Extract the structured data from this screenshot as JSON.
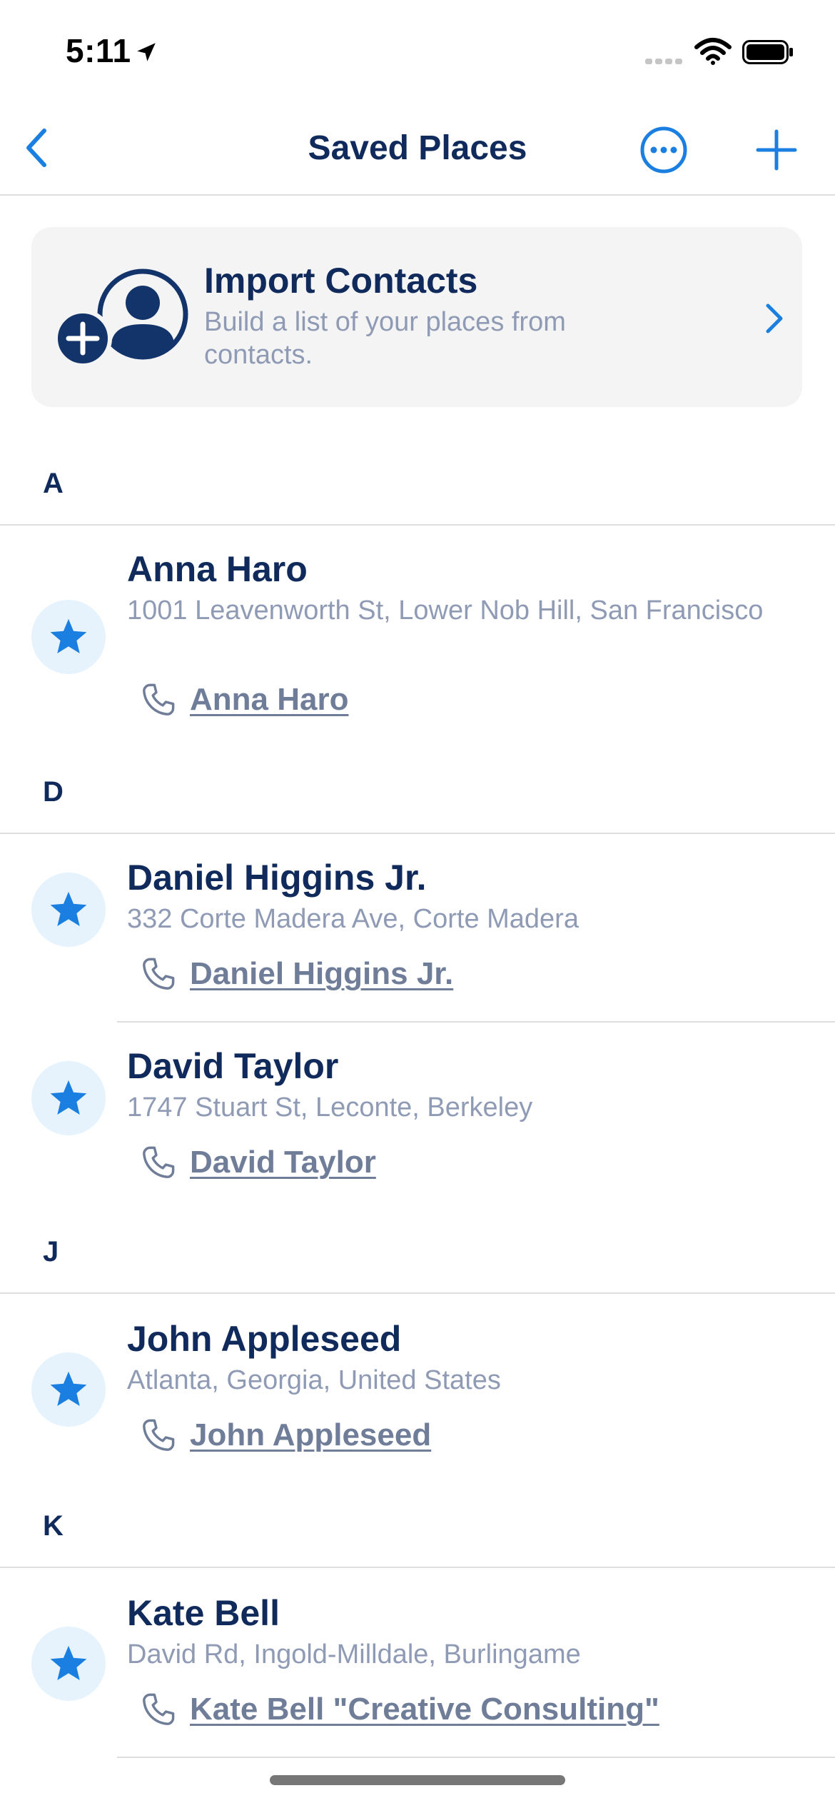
{
  "status_bar": {
    "time": "5:11"
  },
  "nav": {
    "title": "Saved Places"
  },
  "import_card": {
    "title": "Import Contacts",
    "description": "Build a list of your places from contacts."
  },
  "sections": [
    {
      "letter": "A",
      "contacts": [
        {
          "name": "Anna Haro",
          "address": "1001 Leavenworth St, Lower Nob Hill, San Francisco",
          "phone_label": "Anna Haro"
        }
      ]
    },
    {
      "letter": "D",
      "contacts": [
        {
          "name": "Daniel Higgins Jr.",
          "address": "332 Corte Madera Ave, Corte Madera",
          "phone_label": "Daniel Higgins Jr."
        },
        {
          "name": "David Taylor",
          "address": "1747 Stuart St, Leconte, Berkeley",
          "phone_label": "David Taylor"
        }
      ]
    },
    {
      "letter": "J",
      "contacts": [
        {
          "name": "John Appleseed",
          "address": "Atlanta, Georgia, United States",
          "phone_label": "John Appleseed"
        }
      ]
    },
    {
      "letter": "K",
      "contacts": [
        {
          "name": "Kate Bell",
          "address": "David Rd, Ingold-Milldale, Burlingame",
          "phone_label": "Kate Bell \"Creative Consulting\""
        }
      ]
    }
  ],
  "icons": {
    "back": "chevron-left-icon",
    "more": "ellipsis-circle-icon",
    "add": "plus-icon",
    "import": "person-add-icon",
    "disclosure": "chevron-right-icon",
    "favorite": "star-icon",
    "phone": "phone-icon"
  },
  "colors": {
    "accent": "#1a7fe0",
    "title_text": "#102a5c",
    "secondary_text": "#8f9bb5",
    "link_text": "#6f7d99",
    "card_background": "#f4f4f5",
    "star_badge": "#e6f3fd"
  }
}
